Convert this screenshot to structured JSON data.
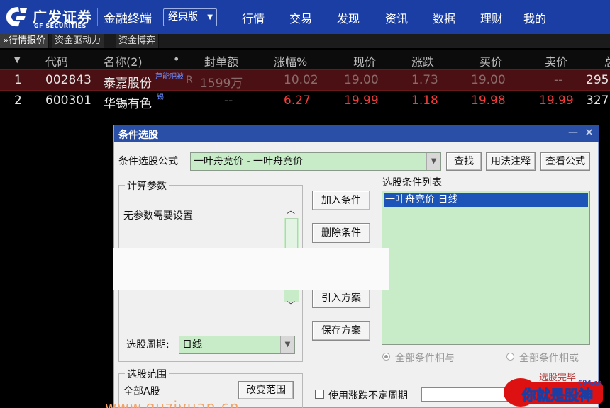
{
  "header": {
    "logo_cn": "广发证券",
    "logo_en": "GF SECURITIES",
    "app_title": "金融终端",
    "edition": "经典版",
    "nav": [
      "行情",
      "交易",
      "发现",
      "资讯",
      "数据",
      "理财",
      "我的"
    ]
  },
  "tabs": [
    {
      "label": "»行情报价",
      "active": true
    },
    {
      "label": "资金驱动力",
      "active": false
    },
    {
      "label": "资金博弈",
      "active": false
    }
  ],
  "table": {
    "sort_arrow": "▼",
    "columns": [
      "代码",
      "名称(2)",
      "•",
      "封单额",
      "涨幅%",
      "现价",
      "涨跌",
      "买价",
      "卖价",
      "总"
    ],
    "rows": [
      {
        "idx": "1",
        "code": "002843",
        "name": "泰嘉股份",
        "tag": "芦能吧被",
        "tag2": "R",
        "seal": "1599万",
        "pct": "10.02",
        "price": "19.00",
        "chg": "1.73",
        "bid": "19.00",
        "ask": "--",
        "vol": "295"
      },
      {
        "idx": "2",
        "code": "600301",
        "name": "华锡有色",
        "tag": "锡",
        "tag2": "",
        "seal": "--",
        "pct": "6.27",
        "price": "19.99",
        "chg": "1.18",
        "bid": "19.98",
        "ask": "19.99",
        "vol": "327"
      }
    ]
  },
  "dialog": {
    "title": "条件选股",
    "formula_label": "条件选股公式",
    "formula_value": "一叶舟竞价   -   一叶舟竞价",
    "btn_find": "查找",
    "btn_usage": "用法注释",
    "btn_view": "查看公式",
    "params_group": "计算参数",
    "params_text": "无参数需要设置",
    "btn_add": "加入条件",
    "btn_delete": "删除条件",
    "btn_import": "引入方案",
    "btn_save": "保存方案",
    "list_title": "选股条件列表",
    "list_items": [
      "一叶舟竞价   日线"
    ],
    "period_label": "选股周期:",
    "period_value": "日线",
    "radio_and": "全部条件相与",
    "radio_or": "全部条件相或",
    "range_group": "选股范围",
    "range_value": "全部A股",
    "btn_range": "改变范围",
    "chk_label": "使用涨跌不定周期"
  },
  "watermark": {
    "status": "选股完毕",
    "url": "www.guziyuan.cn",
    "site": "694.cn",
    "text": "你就是股神"
  }
}
